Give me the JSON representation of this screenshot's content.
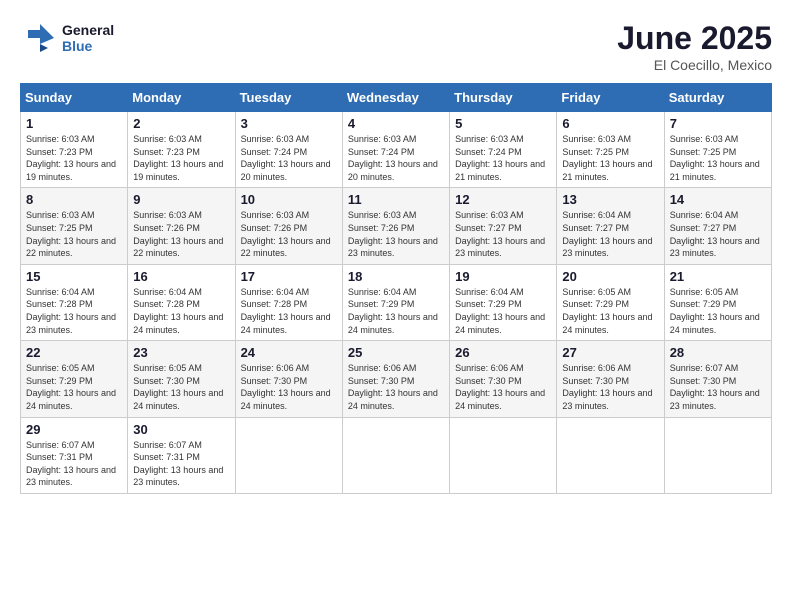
{
  "header": {
    "logo_line1": "General",
    "logo_line2": "Blue",
    "month": "June 2025",
    "location": "El Coecillo, Mexico"
  },
  "weekdays": [
    "Sunday",
    "Monday",
    "Tuesday",
    "Wednesday",
    "Thursday",
    "Friday",
    "Saturday"
  ],
  "weeks": [
    [
      {
        "day": 1,
        "sunrise": "6:03 AM",
        "sunset": "7:23 PM",
        "daylight": "13 hours and 19 minutes."
      },
      {
        "day": 2,
        "sunrise": "6:03 AM",
        "sunset": "7:23 PM",
        "daylight": "13 hours and 19 minutes."
      },
      {
        "day": 3,
        "sunrise": "6:03 AM",
        "sunset": "7:24 PM",
        "daylight": "13 hours and 20 minutes."
      },
      {
        "day": 4,
        "sunrise": "6:03 AM",
        "sunset": "7:24 PM",
        "daylight": "13 hours and 20 minutes."
      },
      {
        "day": 5,
        "sunrise": "6:03 AM",
        "sunset": "7:24 PM",
        "daylight": "13 hours and 21 minutes."
      },
      {
        "day": 6,
        "sunrise": "6:03 AM",
        "sunset": "7:25 PM",
        "daylight": "13 hours and 21 minutes."
      },
      {
        "day": 7,
        "sunrise": "6:03 AM",
        "sunset": "7:25 PM",
        "daylight": "13 hours and 21 minutes."
      }
    ],
    [
      {
        "day": 8,
        "sunrise": "6:03 AM",
        "sunset": "7:25 PM",
        "daylight": "13 hours and 22 minutes."
      },
      {
        "day": 9,
        "sunrise": "6:03 AM",
        "sunset": "7:26 PM",
        "daylight": "13 hours and 22 minutes."
      },
      {
        "day": 10,
        "sunrise": "6:03 AM",
        "sunset": "7:26 PM",
        "daylight": "13 hours and 22 minutes."
      },
      {
        "day": 11,
        "sunrise": "6:03 AM",
        "sunset": "7:26 PM",
        "daylight": "13 hours and 23 minutes."
      },
      {
        "day": 12,
        "sunrise": "6:03 AM",
        "sunset": "7:27 PM",
        "daylight": "13 hours and 23 minutes."
      },
      {
        "day": 13,
        "sunrise": "6:04 AM",
        "sunset": "7:27 PM",
        "daylight": "13 hours and 23 minutes."
      },
      {
        "day": 14,
        "sunrise": "6:04 AM",
        "sunset": "7:27 PM",
        "daylight": "13 hours and 23 minutes."
      }
    ],
    [
      {
        "day": 15,
        "sunrise": "6:04 AM",
        "sunset": "7:28 PM",
        "daylight": "13 hours and 23 minutes."
      },
      {
        "day": 16,
        "sunrise": "6:04 AM",
        "sunset": "7:28 PM",
        "daylight": "13 hours and 24 minutes."
      },
      {
        "day": 17,
        "sunrise": "6:04 AM",
        "sunset": "7:28 PM",
        "daylight": "13 hours and 24 minutes."
      },
      {
        "day": 18,
        "sunrise": "6:04 AM",
        "sunset": "7:29 PM",
        "daylight": "13 hours and 24 minutes."
      },
      {
        "day": 19,
        "sunrise": "6:04 AM",
        "sunset": "7:29 PM",
        "daylight": "13 hours and 24 minutes."
      },
      {
        "day": 20,
        "sunrise": "6:05 AM",
        "sunset": "7:29 PM",
        "daylight": "13 hours and 24 minutes."
      },
      {
        "day": 21,
        "sunrise": "6:05 AM",
        "sunset": "7:29 PM",
        "daylight": "13 hours and 24 minutes."
      }
    ],
    [
      {
        "day": 22,
        "sunrise": "6:05 AM",
        "sunset": "7:29 PM",
        "daylight": "13 hours and 24 minutes."
      },
      {
        "day": 23,
        "sunrise": "6:05 AM",
        "sunset": "7:30 PM",
        "daylight": "13 hours and 24 minutes."
      },
      {
        "day": 24,
        "sunrise": "6:06 AM",
        "sunset": "7:30 PM",
        "daylight": "13 hours and 24 minutes."
      },
      {
        "day": 25,
        "sunrise": "6:06 AM",
        "sunset": "7:30 PM",
        "daylight": "13 hours and 24 minutes."
      },
      {
        "day": 26,
        "sunrise": "6:06 AM",
        "sunset": "7:30 PM",
        "daylight": "13 hours and 24 minutes."
      },
      {
        "day": 27,
        "sunrise": "6:06 AM",
        "sunset": "7:30 PM",
        "daylight": "13 hours and 23 minutes."
      },
      {
        "day": 28,
        "sunrise": "6:07 AM",
        "sunset": "7:30 PM",
        "daylight": "13 hours and 23 minutes."
      }
    ],
    [
      {
        "day": 29,
        "sunrise": "6:07 AM",
        "sunset": "7:31 PM",
        "daylight": "13 hours and 23 minutes."
      },
      {
        "day": 30,
        "sunrise": "6:07 AM",
        "sunset": "7:31 PM",
        "daylight": "13 hours and 23 minutes."
      },
      null,
      null,
      null,
      null,
      null
    ]
  ]
}
